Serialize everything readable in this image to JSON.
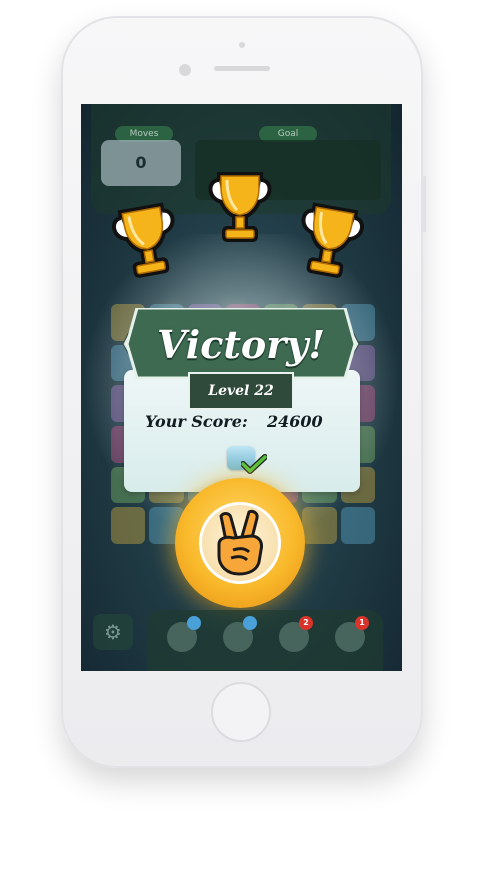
{
  "hud": {
    "moves_label": "Moves",
    "moves_value": "0",
    "goal_label": "Goal"
  },
  "result": {
    "title": "Victory!",
    "level": "Level 22",
    "score_label": "Your Score:",
    "score_value": "24600",
    "stars_earned": 3,
    "goal_completed": true
  },
  "icons": {
    "trophy": "trophy-icon",
    "continue_button": "peace-hand-icon",
    "settings": "gear-icon",
    "check": "check-icon"
  },
  "boosters": [
    {
      "badge": "",
      "color": "#4aa0d8"
    },
    {
      "badge": "",
      "color": "#4aa0d8"
    },
    {
      "badge": "2",
      "color": "#d9342b"
    },
    {
      "badge": "1",
      "color": "#d9342b"
    }
  ],
  "colors": {
    "banner": "#3e6a52",
    "panel": "#e7f3f3",
    "button_gold": "#f9b92b"
  }
}
